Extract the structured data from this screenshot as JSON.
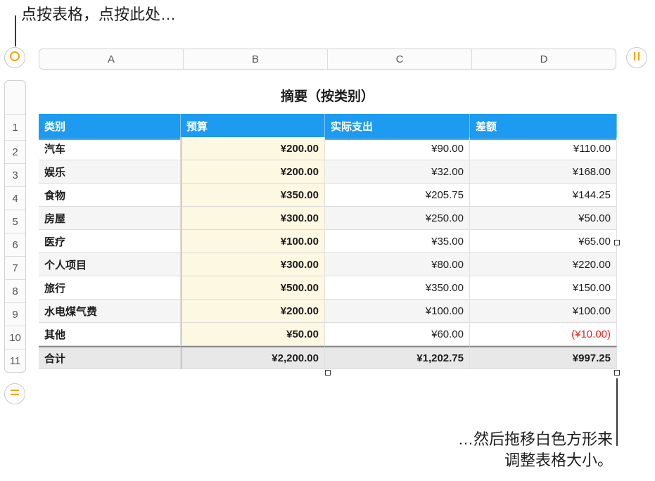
{
  "callouts": {
    "top": "点按表格，点按此处…",
    "bottom_line1": "…然后拖移白色方形来",
    "bottom_line2": "调整表格大小。"
  },
  "table": {
    "title": "摘要（按类别）",
    "column_letters": [
      "A",
      "B",
      "C",
      "D"
    ],
    "row_numbers": [
      "1",
      "2",
      "3",
      "4",
      "5",
      "6",
      "7",
      "8",
      "9",
      "10",
      "11"
    ],
    "headers": [
      "类别",
      "预算",
      "实际支出",
      "差额"
    ],
    "rows": [
      [
        "汽车",
        "¥200.00",
        "¥90.00",
        "¥110.00"
      ],
      [
        "娱乐",
        "¥200.00",
        "¥32.00",
        "¥168.00"
      ],
      [
        "食物",
        "¥350.00",
        "¥205.75",
        "¥144.25"
      ],
      [
        "房屋",
        "¥300.00",
        "¥250.00",
        "¥50.00"
      ],
      [
        "医疗",
        "¥100.00",
        "¥35.00",
        "¥65.00"
      ],
      [
        "个人项目",
        "¥300.00",
        "¥80.00",
        "¥220.00"
      ],
      [
        "旅行",
        "¥500.00",
        "¥350.00",
        "¥150.00"
      ],
      [
        "水电煤气费",
        "¥200.00",
        "¥100.00",
        "¥100.00"
      ],
      [
        "其他",
        "¥50.00",
        "¥60.00",
        "(¥10.00)"
      ]
    ],
    "total": [
      "合计",
      "¥2,200.00",
      "¥1,202.75",
      "¥997.25"
    ]
  },
  "colors": {
    "header_bg": "#1d9bf0",
    "budget_bg": "#fdf8e1",
    "negative": "#e0261f",
    "control_accent": "#f2a516"
  },
  "icons": {
    "table_select": "circle-select-icon",
    "freeze_columns": "column-pause-icon",
    "add_rows": "equals-icon"
  }
}
